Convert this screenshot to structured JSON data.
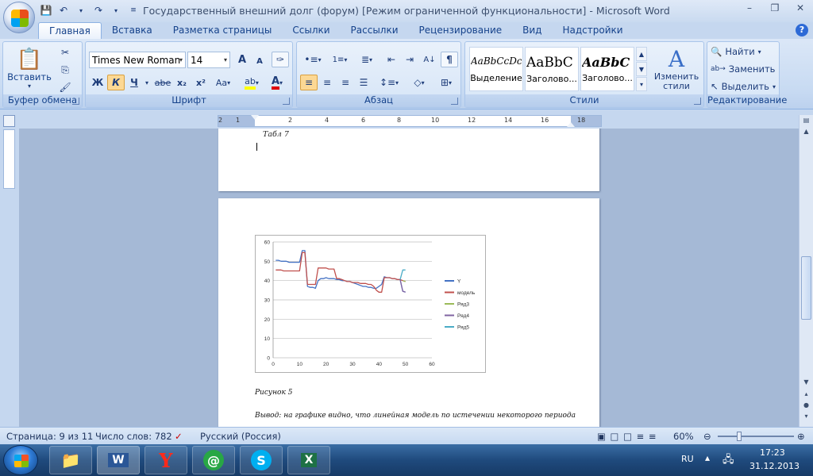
{
  "window": {
    "title": "Государственный внешний долг (форум) [Режим ограниченной функциональности] - Microsoft Word"
  },
  "quick_access": {
    "save_icon": "save-icon",
    "undo_icon": "undo-icon",
    "redo_icon": "redo-icon"
  },
  "tabs": [
    {
      "label": "Главная",
      "active": true
    },
    {
      "label": "Вставка"
    },
    {
      "label": "Разметка страницы"
    },
    {
      "label": "Ссылки"
    },
    {
      "label": "Рассылки"
    },
    {
      "label": "Рецензирование"
    },
    {
      "label": "Вид"
    },
    {
      "label": "Надстройки"
    }
  ],
  "ribbon": {
    "clipboard": {
      "label": "Буфер обмена",
      "paste_label": "Вставить"
    },
    "font": {
      "label": "Шрифт",
      "font_name": "Times New Roman",
      "font_size": "14",
      "bold": "Ж",
      "italic": "К",
      "underline": "Ч",
      "strike": "abe",
      "subscript": "x₂",
      "superscript": "x²",
      "case": "Aa",
      "grow": "A",
      "shrink": "A"
    },
    "paragraph": {
      "label": "Абзац"
    },
    "styles": {
      "label": "Стили",
      "items": [
        {
          "preview": "AaBbCcDc",
          "name": "Выделение"
        },
        {
          "preview": "AaBbC",
          "name": "Заголово..."
        },
        {
          "preview": "AaBbC",
          "name": "Заголово..."
        }
      ],
      "change_styles": "Изменить стили"
    },
    "editing": {
      "label": "Редактирование",
      "find": "Найти",
      "replace": "Заменить",
      "select": "Выделить"
    }
  },
  "ruler": {
    "numbers": [
      "2",
      "1",
      "2",
      "4",
      "6",
      "8",
      "10",
      "12",
      "14",
      "16",
      "18"
    ]
  },
  "document": {
    "table_caption": "Табл 7",
    "figure_caption": "Рисунок 5",
    "conclusion": "Вывод: на графике видно, что линейная модель по истечении некоторого периода"
  },
  "chart_data": {
    "type": "line",
    "xlim": [
      0,
      60
    ],
    "ylim": [
      0,
      60
    ],
    "xticks": [
      "0",
      "10",
      "20",
      "30",
      "40",
      "50",
      "60"
    ],
    "yticks": [
      "0",
      "10",
      "20",
      "30",
      "40",
      "50",
      "60"
    ],
    "grid": true,
    "legend_position": "right",
    "series": [
      {
        "name": "Y",
        "color": "#4472c4",
        "x": [
          1,
          2,
          3,
          4,
          5,
          6,
          7,
          8,
          9,
          10,
          11,
          12,
          13,
          14,
          15,
          16,
          17,
          18,
          19,
          20,
          21,
          22,
          23,
          24,
          25,
          26,
          27,
          28,
          29,
          30,
          31,
          32,
          33,
          34,
          35,
          36,
          37,
          38,
          39,
          40,
          41,
          42,
          43,
          44,
          45,
          46,
          47,
          48,
          49,
          50
        ],
        "values": [
          50.5,
          50.5,
          50,
          50,
          50,
          49.5,
          49.5,
          49.5,
          49.5,
          49.5,
          55.5,
          55.5,
          37,
          36.5,
          36.5,
          36,
          40,
          41,
          41,
          41.5,
          41,
          41,
          41,
          40.5,
          40.5,
          40,
          40,
          39.5,
          39.5,
          39,
          38.5,
          38,
          37.5,
          37,
          37,
          36.5,
          36.5,
          36,
          36,
          37,
          38,
          42,
          41.5,
          41.5,
          41,
          41,
          40.5,
          40.5,
          34.5,
          34
        ]
      },
      {
        "name": "модель",
        "color": "#c0504d",
        "x": [
          1,
          2,
          3,
          4,
          5,
          6,
          7,
          8,
          9,
          10,
          11,
          12,
          13,
          14,
          15,
          16,
          17,
          18,
          19,
          20,
          21,
          22,
          23,
          24,
          25,
          26,
          27,
          28,
          29,
          30,
          31,
          32,
          33,
          34,
          35,
          36,
          37,
          38,
          39,
          40,
          41,
          42,
          43,
          44,
          45,
          46,
          47,
          48,
          49,
          50
        ],
        "values": [
          45.5,
          45.5,
          45.5,
          45,
          45,
          45,
          45,
          45,
          45,
          45,
          54.5,
          54.5,
          38,
          38,
          38,
          38,
          46.5,
          46.5,
          46.5,
          46.5,
          46,
          46,
          46,
          41,
          41,
          40.5,
          40,
          39.5,
          39.5,
          39,
          39,
          39,
          38.5,
          38.5,
          38.5,
          38,
          38,
          37,
          35,
          34,
          34,
          41.5,
          41.5,
          41.5,
          41,
          41,
          40.5,
          40.5,
          40,
          39.5
        ]
      },
      {
        "name": "Ряд3",
        "color": "#9bbb59",
        "x": [
          49,
          50
        ],
        "values": [
          40,
          39.5
        ]
      },
      {
        "name": "Ряд4",
        "color": "#8064a2",
        "x": [
          48,
          49,
          50
        ],
        "values": [
          40.5,
          34.5,
          34
        ]
      },
      {
        "name": "Ряд5",
        "color": "#4bacc6",
        "x": [
          48,
          49,
          50
        ],
        "values": [
          40.5,
          45.5,
          45.5
        ]
      }
    ]
  },
  "status": {
    "page": "Страница: 9 из 11",
    "words": "Число слов: 782",
    "language": "Русский (Россия)",
    "zoom": "60%"
  },
  "taskbar": {
    "lang": "RU",
    "time": "17:23",
    "date": "31.12.2013"
  }
}
